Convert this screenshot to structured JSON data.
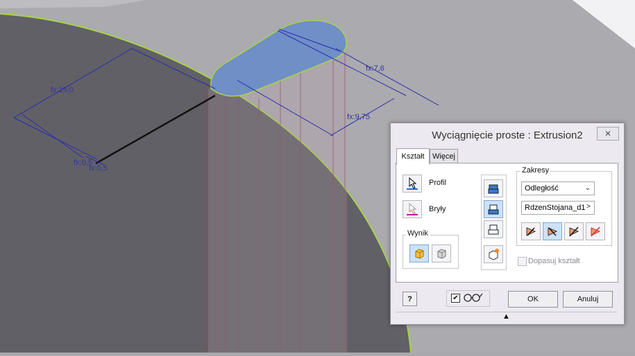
{
  "dimensions": {
    "d1": "fx:7,6",
    "d2": "fx:9,75",
    "d3": "fx:15,0",
    "d4": "fx:0,5",
    "d5": "fx:0,5"
  },
  "dialog": {
    "title": "Wyciągnięcie proste : Extrusion2",
    "close": "✕",
    "tabs": [
      "Kształt",
      "Więcej"
    ],
    "shape": {
      "profile_label": "Profil",
      "solids_label": "Bryły",
      "output_label": "Wynik"
    },
    "extents": {
      "label": "Zakresy",
      "type": "Odległość",
      "distance": "RdzenStojana_d1",
      "distance_more": ">"
    },
    "match_shape_label": "Dopasuj kształt",
    "ok_label": "OK",
    "cancel_label": "Anuluj",
    "help_label": "?",
    "preview_check": "✔",
    "expand_arrow": "▲"
  },
  "colors": {
    "accent_blue": "#7ea6d6",
    "profile_fill": "#6f8fc6",
    "edge_green": "#a9d24a",
    "dimension_blue": "#2b2bb0"
  }
}
